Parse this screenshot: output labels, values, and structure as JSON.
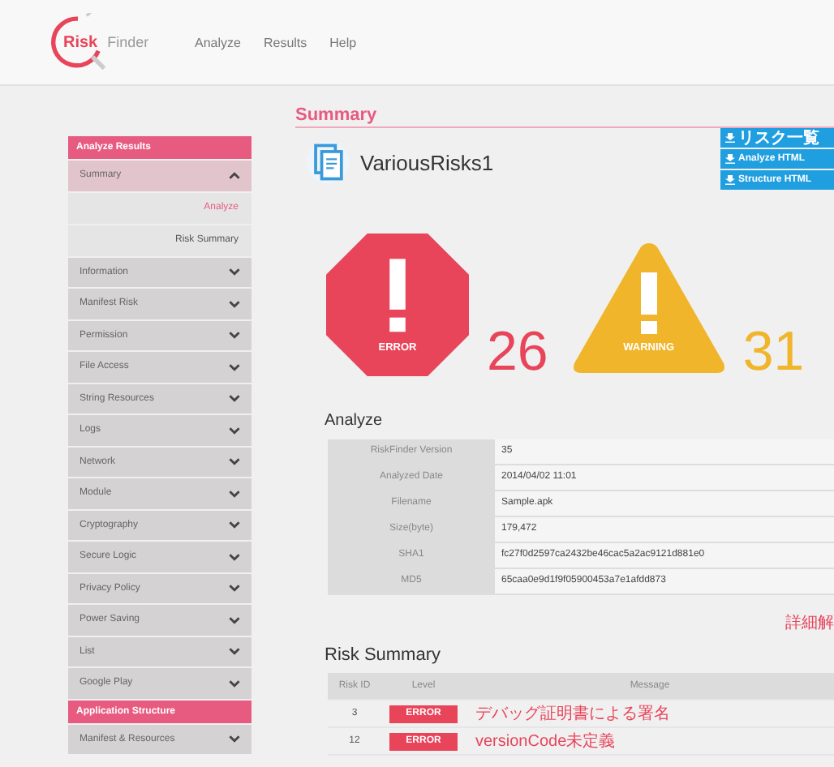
{
  "logo": {
    "main": "Risk",
    "sub": "Finder"
  },
  "nav": [
    "Analyze",
    "Results",
    "Help"
  ],
  "sidebar": [
    {
      "kind": "header",
      "label": "Analyze Results"
    },
    {
      "kind": "item",
      "label": "Summary",
      "expanded": true,
      "children": [
        {
          "label": "Analyze",
          "selected": true
        },
        {
          "label": "Risk Summary",
          "selected": false
        }
      ]
    },
    {
      "kind": "item",
      "label": "Information",
      "expanded": false
    },
    {
      "kind": "item",
      "label": "Manifest Risk",
      "expanded": false
    },
    {
      "kind": "item",
      "label": "Permission",
      "expanded": false
    },
    {
      "kind": "item",
      "label": "File Access",
      "expanded": false
    },
    {
      "kind": "item",
      "label": "String Resources",
      "expanded": false
    },
    {
      "kind": "item",
      "label": "Logs",
      "expanded": false
    },
    {
      "kind": "item",
      "label": "Network",
      "expanded": false
    },
    {
      "kind": "item",
      "label": "Module",
      "expanded": false
    },
    {
      "kind": "item",
      "label": "Cryptography",
      "expanded": false
    },
    {
      "kind": "item",
      "label": "Secure Logic",
      "expanded": false
    },
    {
      "kind": "item",
      "label": "Privacy Policy",
      "expanded": false
    },
    {
      "kind": "item",
      "label": "Power Saving",
      "expanded": false
    },
    {
      "kind": "item",
      "label": "List",
      "expanded": false
    },
    {
      "kind": "item",
      "label": "Google Play",
      "expanded": false
    },
    {
      "kind": "header",
      "label": "Application Structure"
    },
    {
      "kind": "item",
      "label": "Manifest & Resources",
      "expanded": false
    }
  ],
  "summary": {
    "heading": "Summary",
    "app_name": "VariousRisks1",
    "downloads": [
      "リスク一覧",
      "Analyze HTML",
      "Structure HTML"
    ],
    "badges": [
      {
        "kind": "error",
        "label": "ERROR",
        "count": "26"
      },
      {
        "kind": "warning",
        "label": "WARNING",
        "count": "31"
      }
    ]
  },
  "analyze": {
    "heading": "Analyze",
    "rows": [
      {
        "label": "RiskFinder Version",
        "value": "35"
      },
      {
        "label": "Analyzed Date",
        "value": "2014/04/02 11:01"
      },
      {
        "label": "Filename",
        "value": "Sample.apk"
      },
      {
        "label": "Size(byte)",
        "value": "179,472"
      },
      {
        "label": "SHA1",
        "value": "fc27f0d2597ca2432be46cac5a2ac9121d881e0"
      },
      {
        "label": "MD5",
        "value": "65caa0e9d1f9f05900453a7e1afdd873"
      }
    ],
    "link": "詳細解"
  },
  "risk_summary": {
    "heading": "Risk Summary",
    "columns": [
      "Risk ID",
      "Level",
      "Message"
    ],
    "rows": [
      {
        "id": "3",
        "level": "ERROR",
        "kind": "error",
        "message": "デバッグ証明書による署名"
      },
      {
        "id": "12",
        "level": "ERROR",
        "kind": "error",
        "message": "versionCode未定義"
      }
    ]
  }
}
